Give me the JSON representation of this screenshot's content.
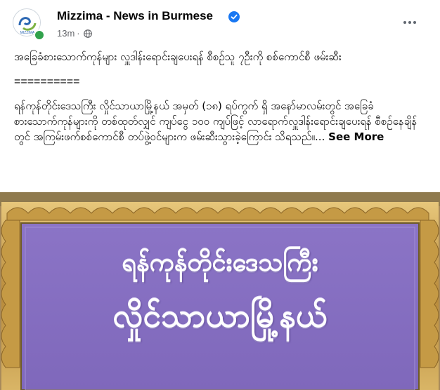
{
  "post": {
    "page_name": "Mizzima - News in Burmese",
    "time": "13m",
    "separator_dot": "·",
    "headline": "အခြေခံစားသောက်ကုန်များ လှူဒါန်းရောင်းချပေးရန် စီစဉ်သူ ၇ဦးကို စစ်ကောင်စီ ဖမ်းဆီး",
    "separator": "==========",
    "detail": "ရန်ကုန်တိုင်းဒေသကြီး လှိုင်သာယာမြို့နယ် အမှတ် (၁၈) ရပ်ကွက် ရှိ အနော်မာလမ်းတွင် အခြေခံစားသောက်ကုန်များကို တစ်ထုတ်လျှင် ကျပ်ငွေ ၁၀၀ ကျပ်ဖြင့် လာရောက်လှူဒါန်းရောင်းချပေးရန် စီစဉ်နေချိန်တွင် အကြမ်းဖက်စစ်ကောင်စီ တပ်ဖွဲ့ဝင်များက ဖမ်းဆီးသွားခဲ့ကြောင်း သိရသည်။...",
    "see_more": "See More"
  },
  "avatar": {
    "logo_text": "MIZZIMA"
  },
  "media": {
    "sign_line1": "ရန်ကုန်တိုင်းဒေသကြီး",
    "sign_line2": "လှိုင်သာယာမြို့နယ်",
    "colors": {
      "sign_purple": "#8a73c4",
      "frame_gold": "#c9a253"
    }
  },
  "colors": {
    "text_primary": "#050505",
    "text_secondary": "#65676b",
    "verified_blue": "#1877f2",
    "online_green": "#31a24c"
  }
}
